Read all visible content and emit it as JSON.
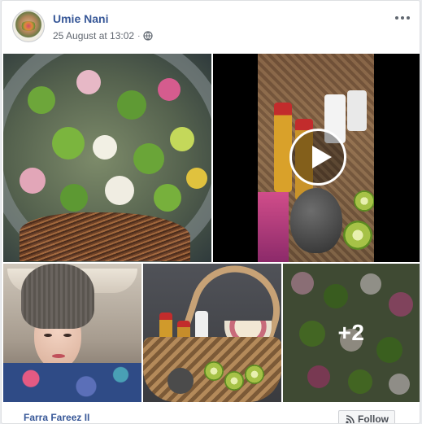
{
  "post": {
    "author": "Umie Nani",
    "date": "25 August at 13:02",
    "separator": "·",
    "privacy_icon": "globe-icon",
    "options_icon": "more-icon"
  },
  "media": {
    "video_icon": "play-icon",
    "more_count": "+2"
  },
  "footer": {
    "commenter": "Farra Fareez II",
    "follow_label": "Follow",
    "follow_icon": "rss-icon"
  },
  "colors": {
    "link": "#385898",
    "meta": "#616770",
    "background": "#e9ebee"
  }
}
